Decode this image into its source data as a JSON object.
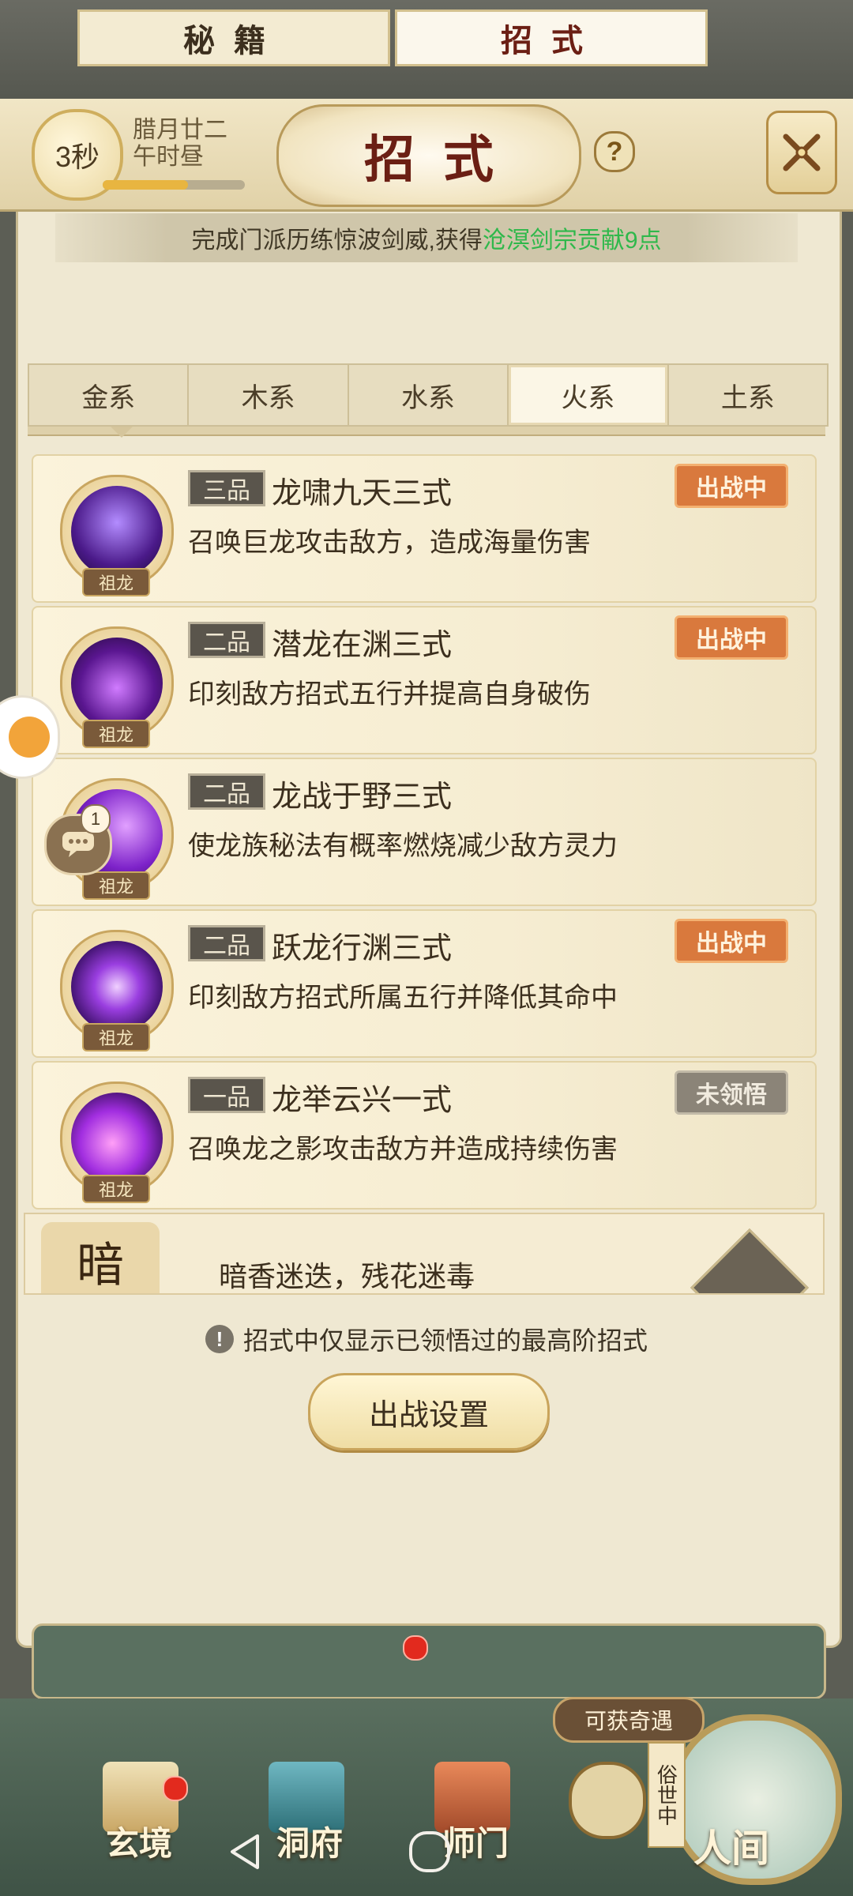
{
  "header": {
    "timer": "3秒",
    "date_line1": "腊月廿二",
    "date_line2": "午时昼",
    "time_progress": 0.6,
    "title": "招式"
  },
  "notice": {
    "prefix": "完成门派历练惊波剑威,获得",
    "highlight": "沧溟剑宗贡献9点"
  },
  "element_tabs": [
    "金系",
    "木系",
    "水系",
    "火系",
    "土系"
  ],
  "active_element_tab": "火系",
  "skills": [
    {
      "grade": "三品",
      "name": "龙啸九天三式",
      "desc": "召唤巨龙攻击敌方，造成海量伤害",
      "tag": "祖龙",
      "status": "出战中",
      "active": true
    },
    {
      "grade": "二品",
      "name": "潜龙在渊三式",
      "desc": "印刻敌方招式五行并提高自身破伤",
      "tag": "祖龙",
      "status": "出战中",
      "active": true
    },
    {
      "grade": "二品",
      "name": "龙战于野三式",
      "desc": "使龙族秘法有概率燃烧减少敌方灵力",
      "tag": "祖龙",
      "status": "",
      "active": false
    },
    {
      "grade": "二品",
      "name": "跃龙行渊三式",
      "desc": "印刻敌方招式所属五行并降低其命中",
      "tag": "祖龙",
      "status": "出战中",
      "active": true
    },
    {
      "grade": "一品",
      "name": "龙举云兴一式",
      "desc": "召唤龙之影攻击敌方并造成持续伤害",
      "tag": "祖龙",
      "status": "未领悟",
      "active": false
    }
  ],
  "partial_card": {
    "seal_text": "暗",
    "desc": "暗香迷迭，残花迷毒"
  },
  "chat_count": "1",
  "hint": "招式中仅显示已领悟过的最高阶招式",
  "battle_button": "出战设置",
  "bottom_tabs": {
    "left": "秘籍",
    "right": "招式"
  },
  "opportunity": "可获奇遇",
  "world_label": "俗世中",
  "nav": {
    "xuanjing": "玄境",
    "dongfu": "洞府",
    "shimen": "师门",
    "renjian": "人间"
  },
  "colors": {
    "active_status": "#d9793d",
    "inactive_status": "#8b8478",
    "highlight_green": "#2fb84b",
    "title_red": "#6b1f14"
  }
}
